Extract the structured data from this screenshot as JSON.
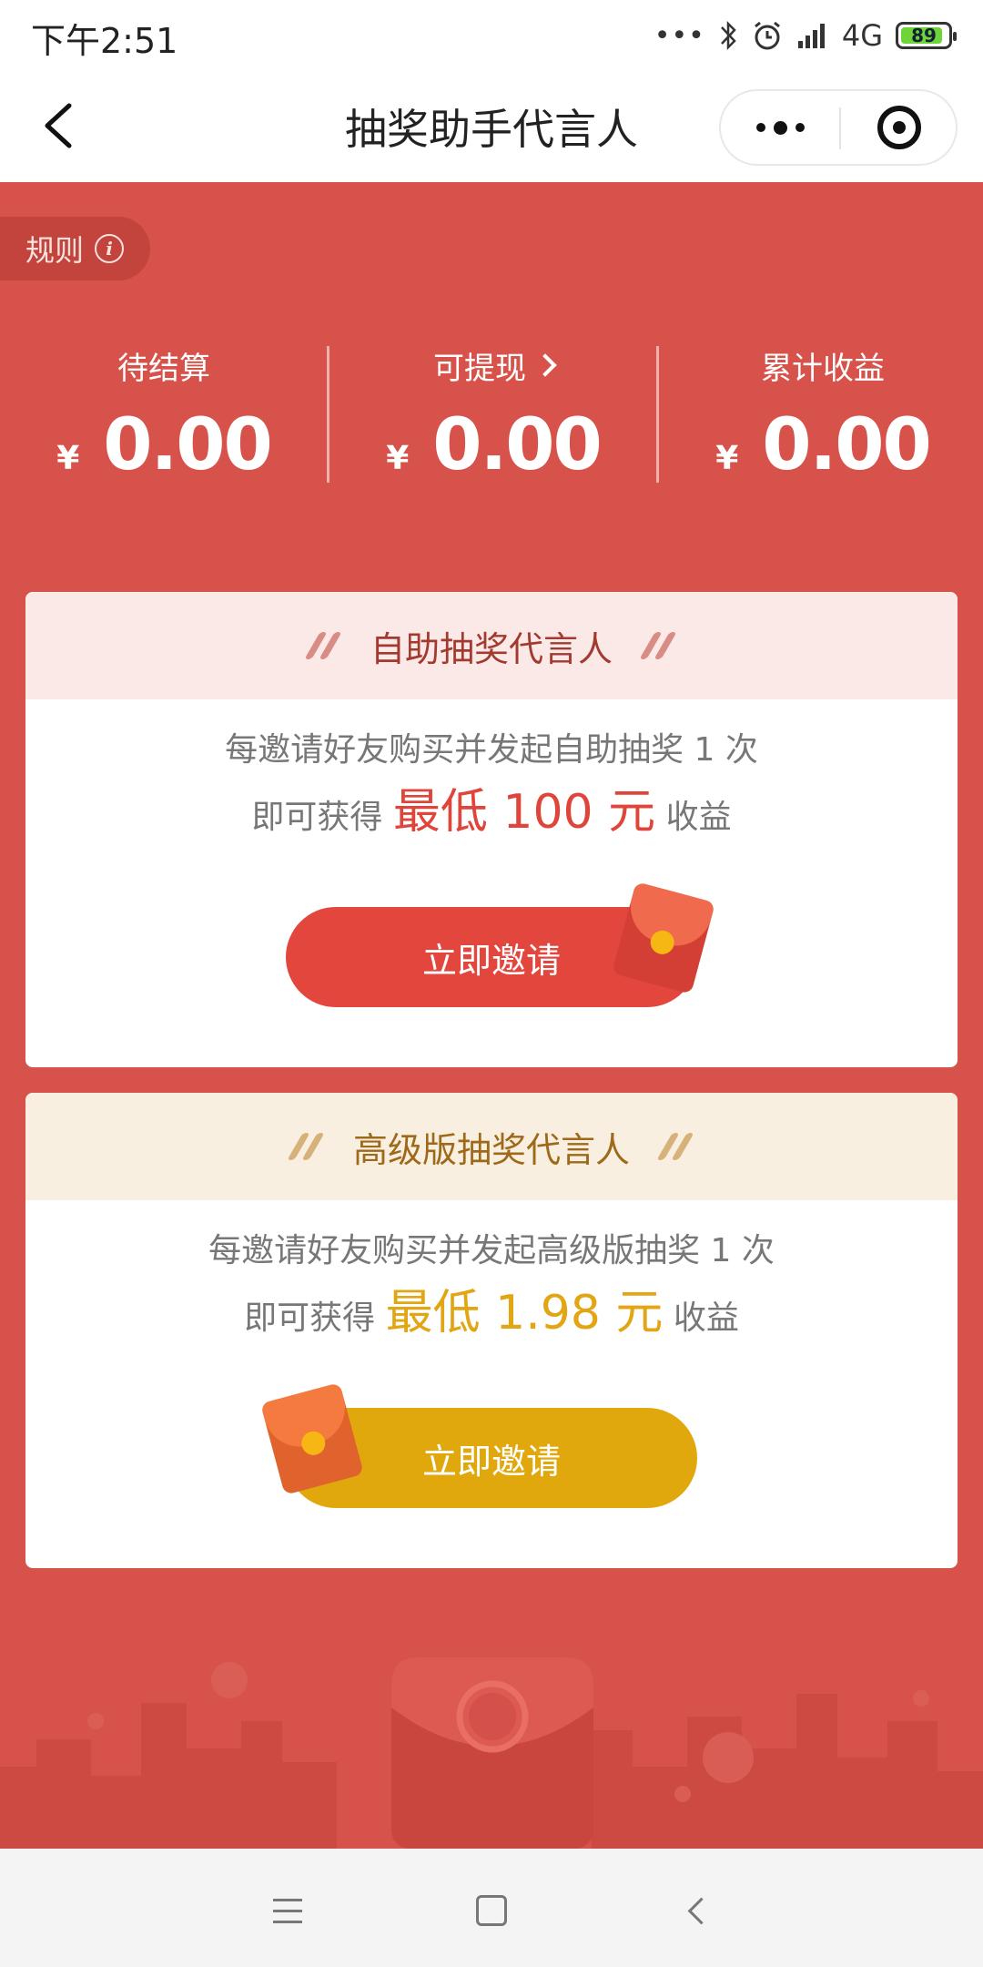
{
  "status_bar": {
    "time": "下午2:51",
    "network": "4G",
    "battery": "89",
    "battery_level": 0.89,
    "icons": [
      "more-dots-icon",
      "bluetooth-icon",
      "alarm-icon",
      "signal-icon",
      "battery-icon"
    ]
  },
  "nav": {
    "title": "抽奖助手代言人",
    "back_icon": "chevron-left-icon",
    "more_icon": "more-dots-icon",
    "close_icon": "target-close-icon"
  },
  "rules": {
    "label": "规则",
    "icon": "info-icon"
  },
  "stats": [
    {
      "label": "待结算",
      "currency": "¥",
      "value": "0.00"
    },
    {
      "label": "可提现",
      "currency": "¥",
      "value": "0.00"
    },
    {
      "label": "累计收益",
      "currency": "¥",
      "value": "0.00"
    }
  ],
  "cards": [
    {
      "title": "自助抽奖代言人",
      "line1": "每邀请好友购买并发起自助抽奖 1 次",
      "line2_prefix": "即可获得 ",
      "highlight": "最低 100 元",
      "line2_suffix": " 收益",
      "button": "立即邀请",
      "accent": "#e2463d"
    },
    {
      "title": "高级版抽奖代言人",
      "line1": "每邀请好友购买并发起高级版抽奖 1 次",
      "line2_prefix": "即可获得 ",
      "highlight": "最低 1.98 元",
      "line2_suffix": " 收益",
      "button": "立即邀请",
      "accent": "#e1a80e"
    }
  ],
  "colors": {
    "background": "#d6524a",
    "card1_header": "#fbe9e7",
    "card2_header": "#f8efe1"
  }
}
